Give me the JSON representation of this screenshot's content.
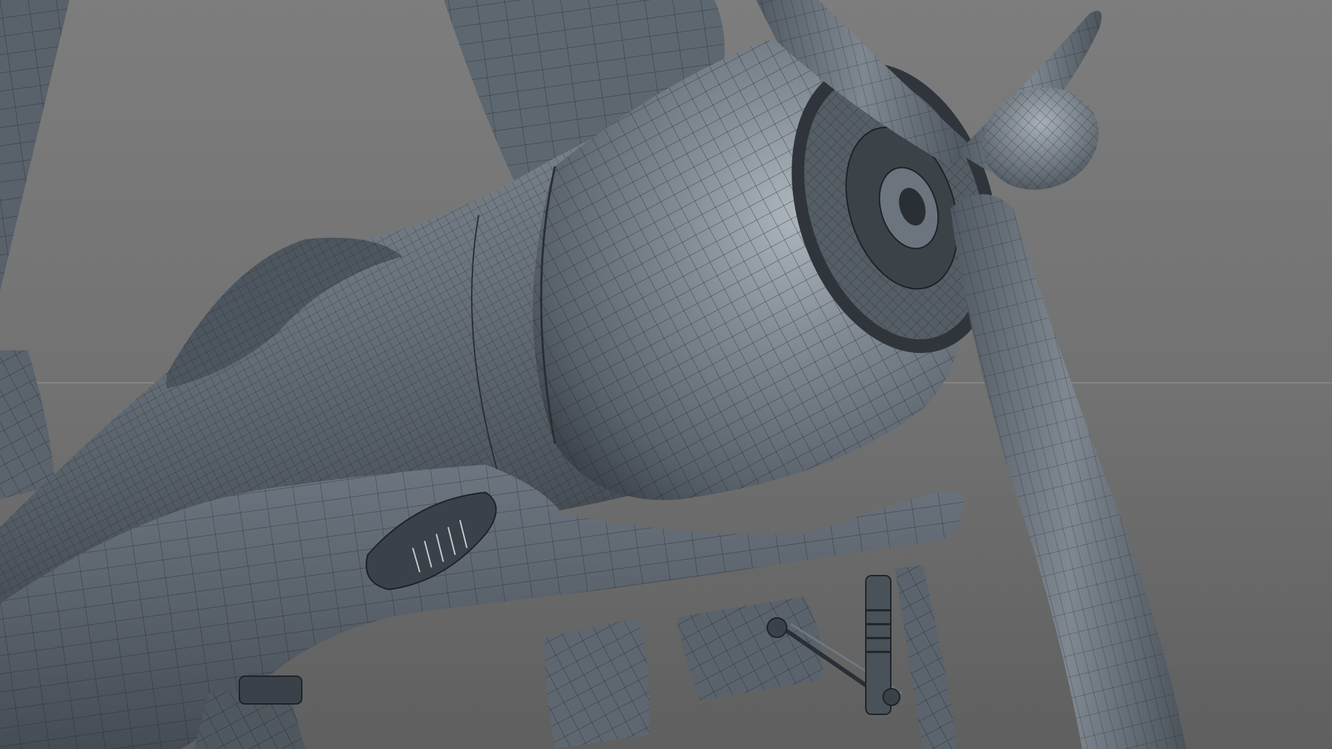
{
  "scene": {
    "subject": "",
    "background_top": "#7c7c7c",
    "background_bottom": "#666666",
    "mesh_fill": "#6c7680",
    "mesh_fill_dark": "#3f474f",
    "mesh_highlight": "#aab2ba",
    "wire_color": "#1e2226",
    "horizon_line": "#9a9a9a"
  }
}
